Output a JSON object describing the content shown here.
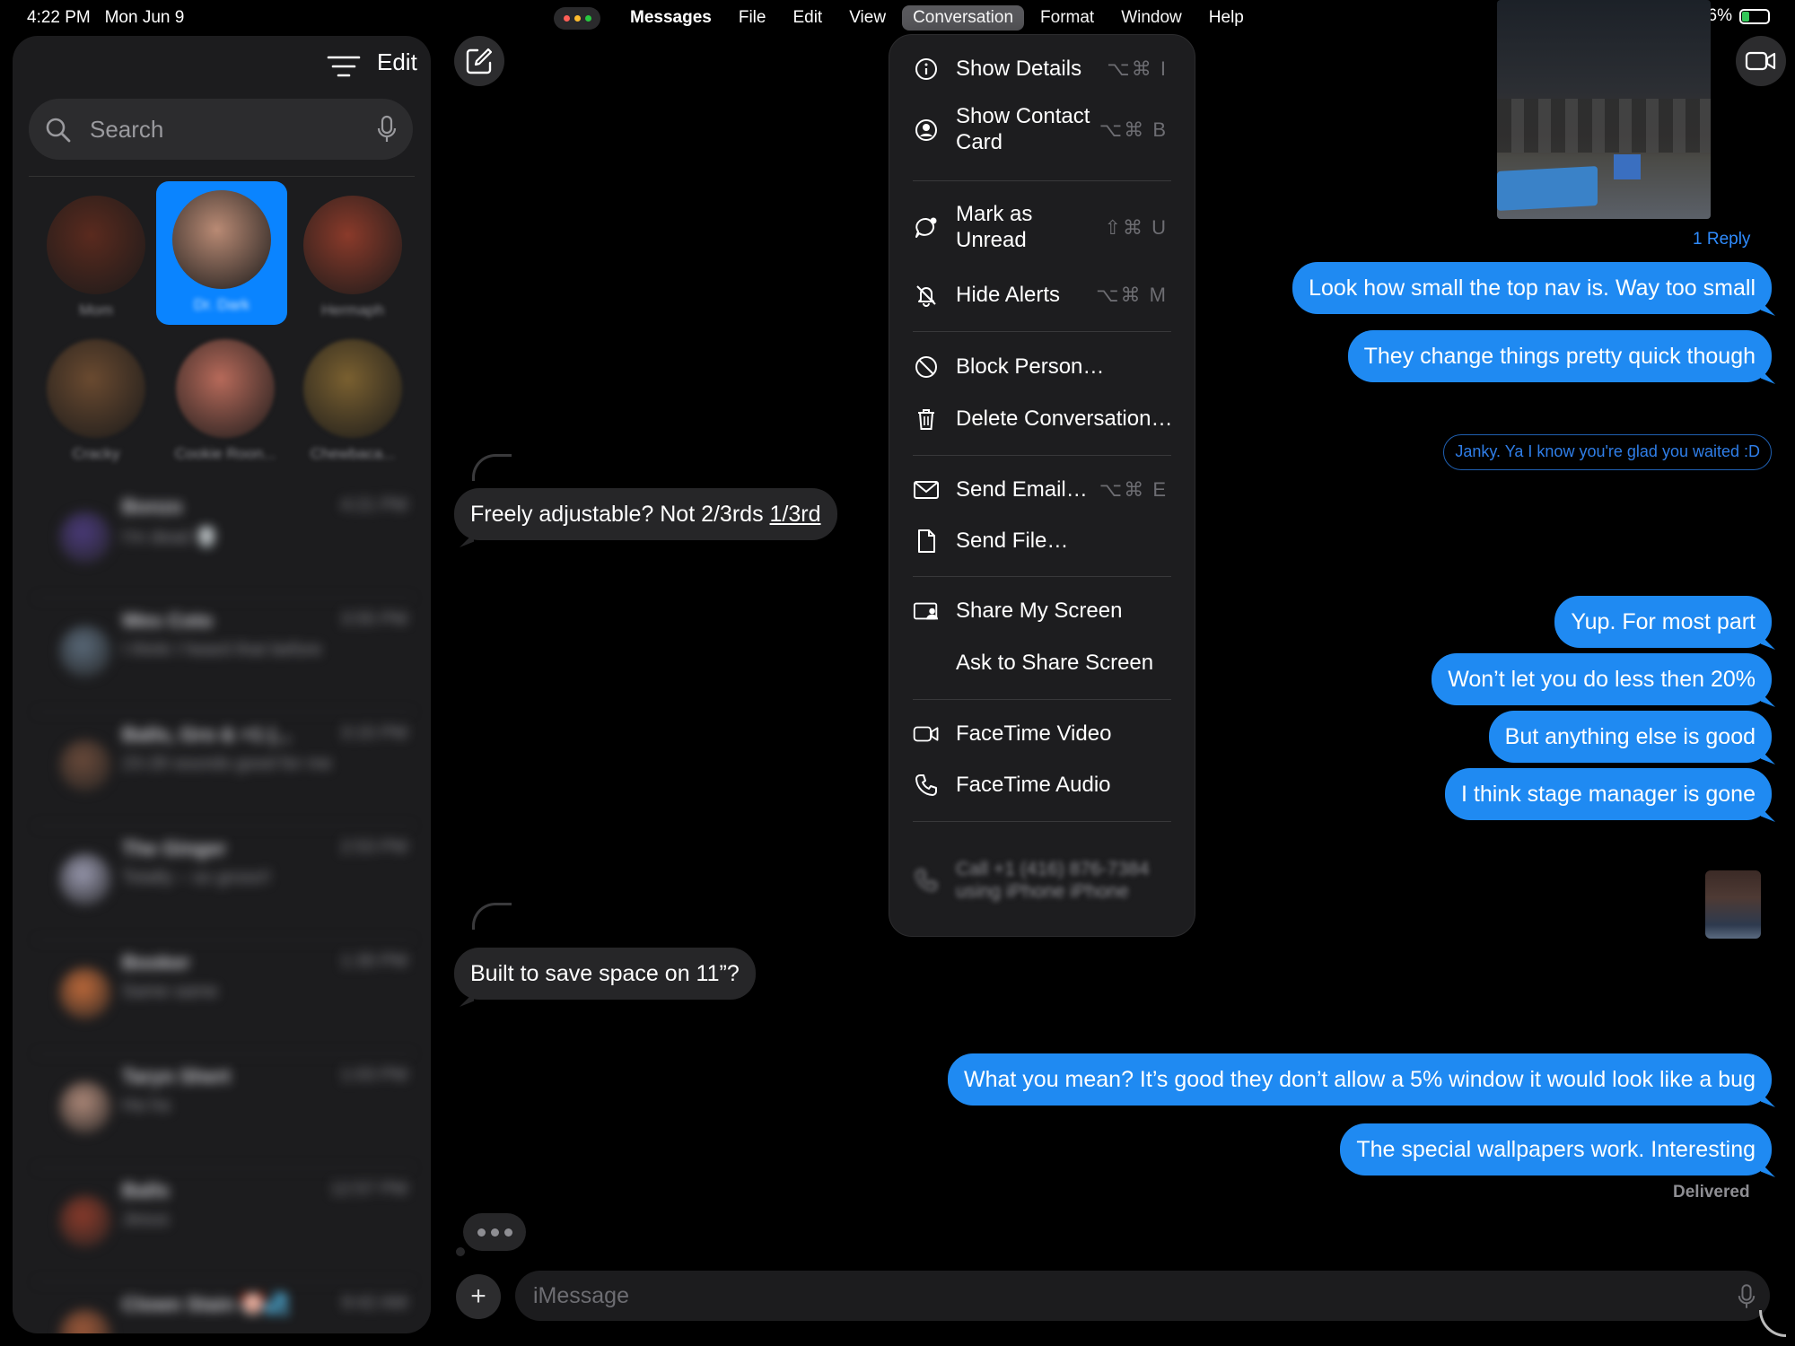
{
  "status_bar": {
    "time": "4:22 PM",
    "date": "Mon Jun 9",
    "battery_percent": "26%",
    "battery_level": 0.26,
    "window_dot_colors": [
      "#ff5f57",
      "#febc2e",
      "#28c840"
    ]
  },
  "menubar": {
    "items": [
      "Messages",
      "File",
      "Edit",
      "View",
      "Conversation",
      "Format",
      "Window",
      "Help"
    ],
    "active": "Conversation"
  },
  "sidebar": {
    "edit_label": "Edit",
    "search_placeholder": "Search",
    "pinned": [
      {
        "name": "Mom",
        "color": "#5a2a1e"
      },
      {
        "name": "Dr. Dark",
        "color": "#b98a74",
        "selected": true
      },
      {
        "name": "Hermaph",
        "color": "#8a3a2a"
      },
      {
        "name": "Cracky",
        "color": "#6a4a30"
      },
      {
        "name": "Cookie Roon...",
        "color": "#b76a5a"
      },
      {
        "name": "Chewbaca...",
        "color": "#7a6030"
      }
    ],
    "conversations": [
      {
        "name": "Bonzo",
        "time": "4:21 PM",
        "preview": "I'm dead 💀",
        "color": "#4a3a7a"
      },
      {
        "name": "Wes Coto",
        "time": "3:55 PM",
        "preview": "I think I heard that before",
        "color": "#5a6a7a"
      },
      {
        "name": "Balls, Gro & +1 (...",
        "time": "3:15 PM",
        "preview": "23-28 sounds good for me",
        "color": "#6a4a3a"
      },
      {
        "name": "The Ginger",
        "time": "2:53 PM",
        "preview": "Totally – so gross!!",
        "color": "#9a9ab0"
      },
      {
        "name": "Booker",
        "time": "1:30 PM",
        "preview": "Same same",
        "color": "#c06a3a"
      },
      {
        "name": "Taryn Shert",
        "time": "1:03 PM",
        "preview": "Ha ha",
        "color": "#b08a7a"
      },
      {
        "name": "Balls",
        "time": "12:57 PM",
        "preview": "Jesus",
        "color": "#8a3a2a"
      },
      {
        "name": "Clown Stain 🤡💦",
        "time": "9:42 AM",
        "preview": "",
        "color": "#a05a3a"
      }
    ]
  },
  "conversation": {
    "reply_link": "1 Reply",
    "messages": [
      {
        "dir": "out",
        "text": "Look how small the top nav is. Way too small"
      },
      {
        "dir": "out",
        "text": "They change things pretty quick though"
      },
      {
        "dir": "out-inline",
        "text": "Janky. Ya I know you're glad you waited :D"
      },
      {
        "dir": "in",
        "text_before": "Freely adjustable? Not 2/3rds ",
        "text_underlined": "1/3rd"
      },
      {
        "dir": "out",
        "text": "Yup. For most part"
      },
      {
        "dir": "out",
        "text": "Won’t let you do less then 20%"
      },
      {
        "dir": "out",
        "text": "But anything else is good"
      },
      {
        "dir": "out",
        "text": "I think stage manager is gone"
      },
      {
        "dir": "in",
        "text": "Built to save space on 11”?"
      },
      {
        "dir": "out",
        "text": "What you mean? It’s good they don’t allow a 5% window it would look like a bug"
      },
      {
        "dir": "out",
        "text": "The special wallpapers work. Interesting"
      }
    ],
    "delivered_label": "Delivered",
    "input_placeholder": "iMessage"
  },
  "dropdown": {
    "items": [
      {
        "label": "Show Details",
        "shortcut": "⌥⌘ I",
        "icon": "info-icon"
      },
      {
        "label": "Show Contact Card",
        "shortcut": "⌥⌘ B",
        "icon": "contact-icon"
      },
      {
        "label": "Mark as Unread",
        "shortcut": "⇧⌘ U",
        "icon": "unread-bubble-icon"
      },
      {
        "label": "Hide Alerts",
        "shortcut": "⌥⌘ M",
        "icon": "bell-slash-icon"
      },
      {
        "label": "Block Person…",
        "shortcut": "",
        "icon": "block-icon"
      },
      {
        "label": "Delete Conversation…",
        "shortcut": "",
        "icon": "trash-icon"
      },
      {
        "label": "Send Email…",
        "shortcut": "⌥⌘ E",
        "icon": "envelope-icon"
      },
      {
        "label": "Send File…",
        "shortcut": "",
        "icon": "document-icon"
      },
      {
        "label": "Share My Screen",
        "shortcut": "",
        "icon": "share-screen-icon"
      },
      {
        "label": "Ask to Share Screen",
        "shortcut": "",
        "icon": ""
      },
      {
        "label": "FaceTime Video",
        "shortcut": "",
        "icon": "video-camera-icon"
      },
      {
        "label": "FaceTime Audio",
        "shortcut": "",
        "icon": "phone-icon"
      },
      {
        "label": "Call +1 (416) 876-7384 using iPhone iPhone",
        "shortcut": "",
        "icon": "phone-icon",
        "disabled": true
      }
    ]
  }
}
